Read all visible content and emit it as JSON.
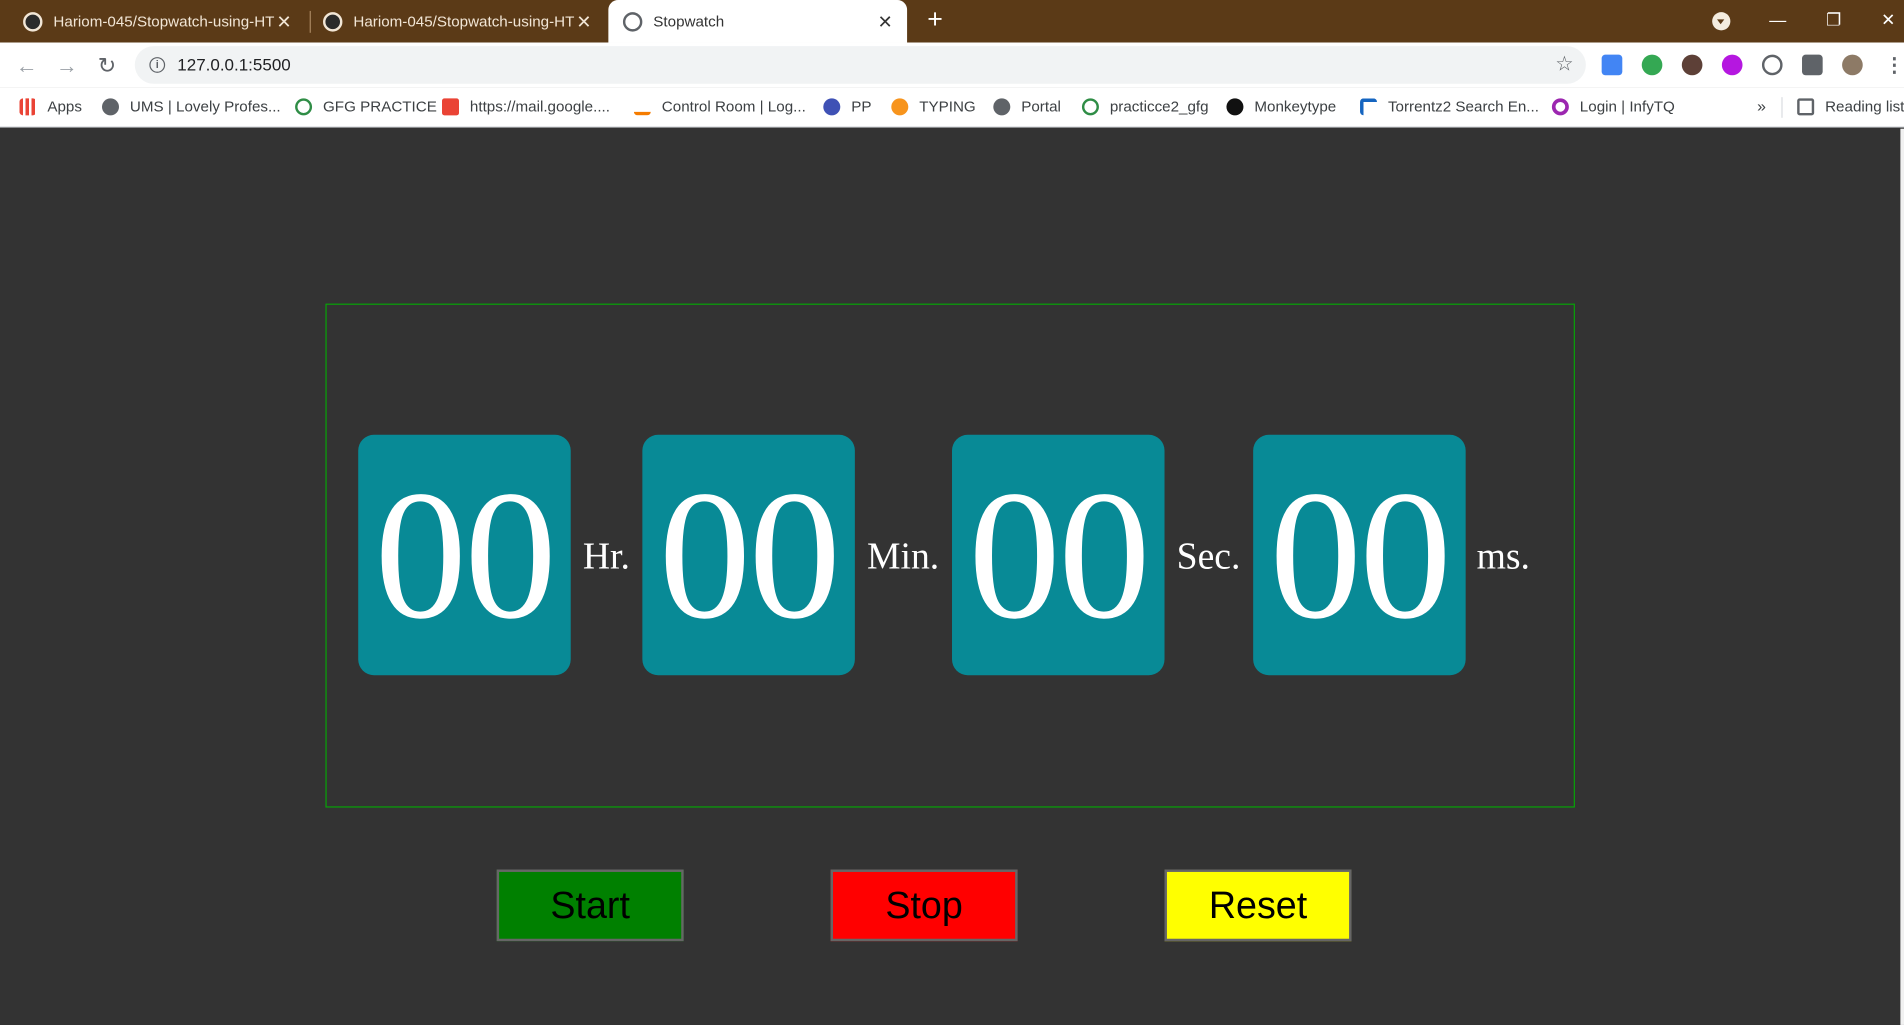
{
  "browser": {
    "tabs": [
      {
        "title": "Hariom-045/Stopwatch-using-HT",
        "active": false
      },
      {
        "title": "Hariom-045/Stopwatch-using-HT",
        "active": false
      },
      {
        "title": "Stopwatch",
        "active": true
      }
    ],
    "url": "127.0.0.1:5500",
    "bookmarks": [
      {
        "label": "Apps",
        "icon": "apps-grid-icon"
      },
      {
        "label": "UMS | Lovely Profes...",
        "icon": "globe-icon"
      },
      {
        "label": "GFG PRACTICE",
        "icon": "gfg-icon"
      },
      {
        "label": "https://mail.google....",
        "icon": "gmail-icon"
      },
      {
        "label": "Control Room | Log...",
        "icon": "triangle-logo-icon"
      },
      {
        "label": "PP",
        "icon": "pp-icon"
      },
      {
        "label": "TYPING",
        "icon": "typing-icon"
      },
      {
        "label": "Portal",
        "icon": "globe-icon"
      },
      {
        "label": "practicce2_gfg",
        "icon": "gfg-icon"
      },
      {
        "label": "Monkeytype",
        "icon": "monkeytype-icon"
      },
      {
        "label": "Torrentz2 Search En...",
        "icon": "torrentz-icon"
      },
      {
        "label": "Login | InfyTQ",
        "icon": "infytq-icon"
      }
    ],
    "more_bookmarks": "»",
    "reading_list": "Reading list"
  },
  "stopwatch": {
    "hours": "00",
    "hours_label": "Hr.",
    "minutes": "00",
    "minutes_label": "Min.",
    "seconds": "00",
    "seconds_label": "Sec.",
    "milliseconds": "00",
    "milliseconds_label": "ms."
  },
  "controls": {
    "start_label": "Start",
    "stop_label": "Stop",
    "reset_label": "Reset"
  },
  "colors": {
    "page_background": "#333333",
    "digit_card": "#088a96",
    "border_accent": "#07a207",
    "start": "#008000",
    "stop": "#ff0000",
    "reset": "#ffff00",
    "browser_frame": "#5b3a17"
  }
}
